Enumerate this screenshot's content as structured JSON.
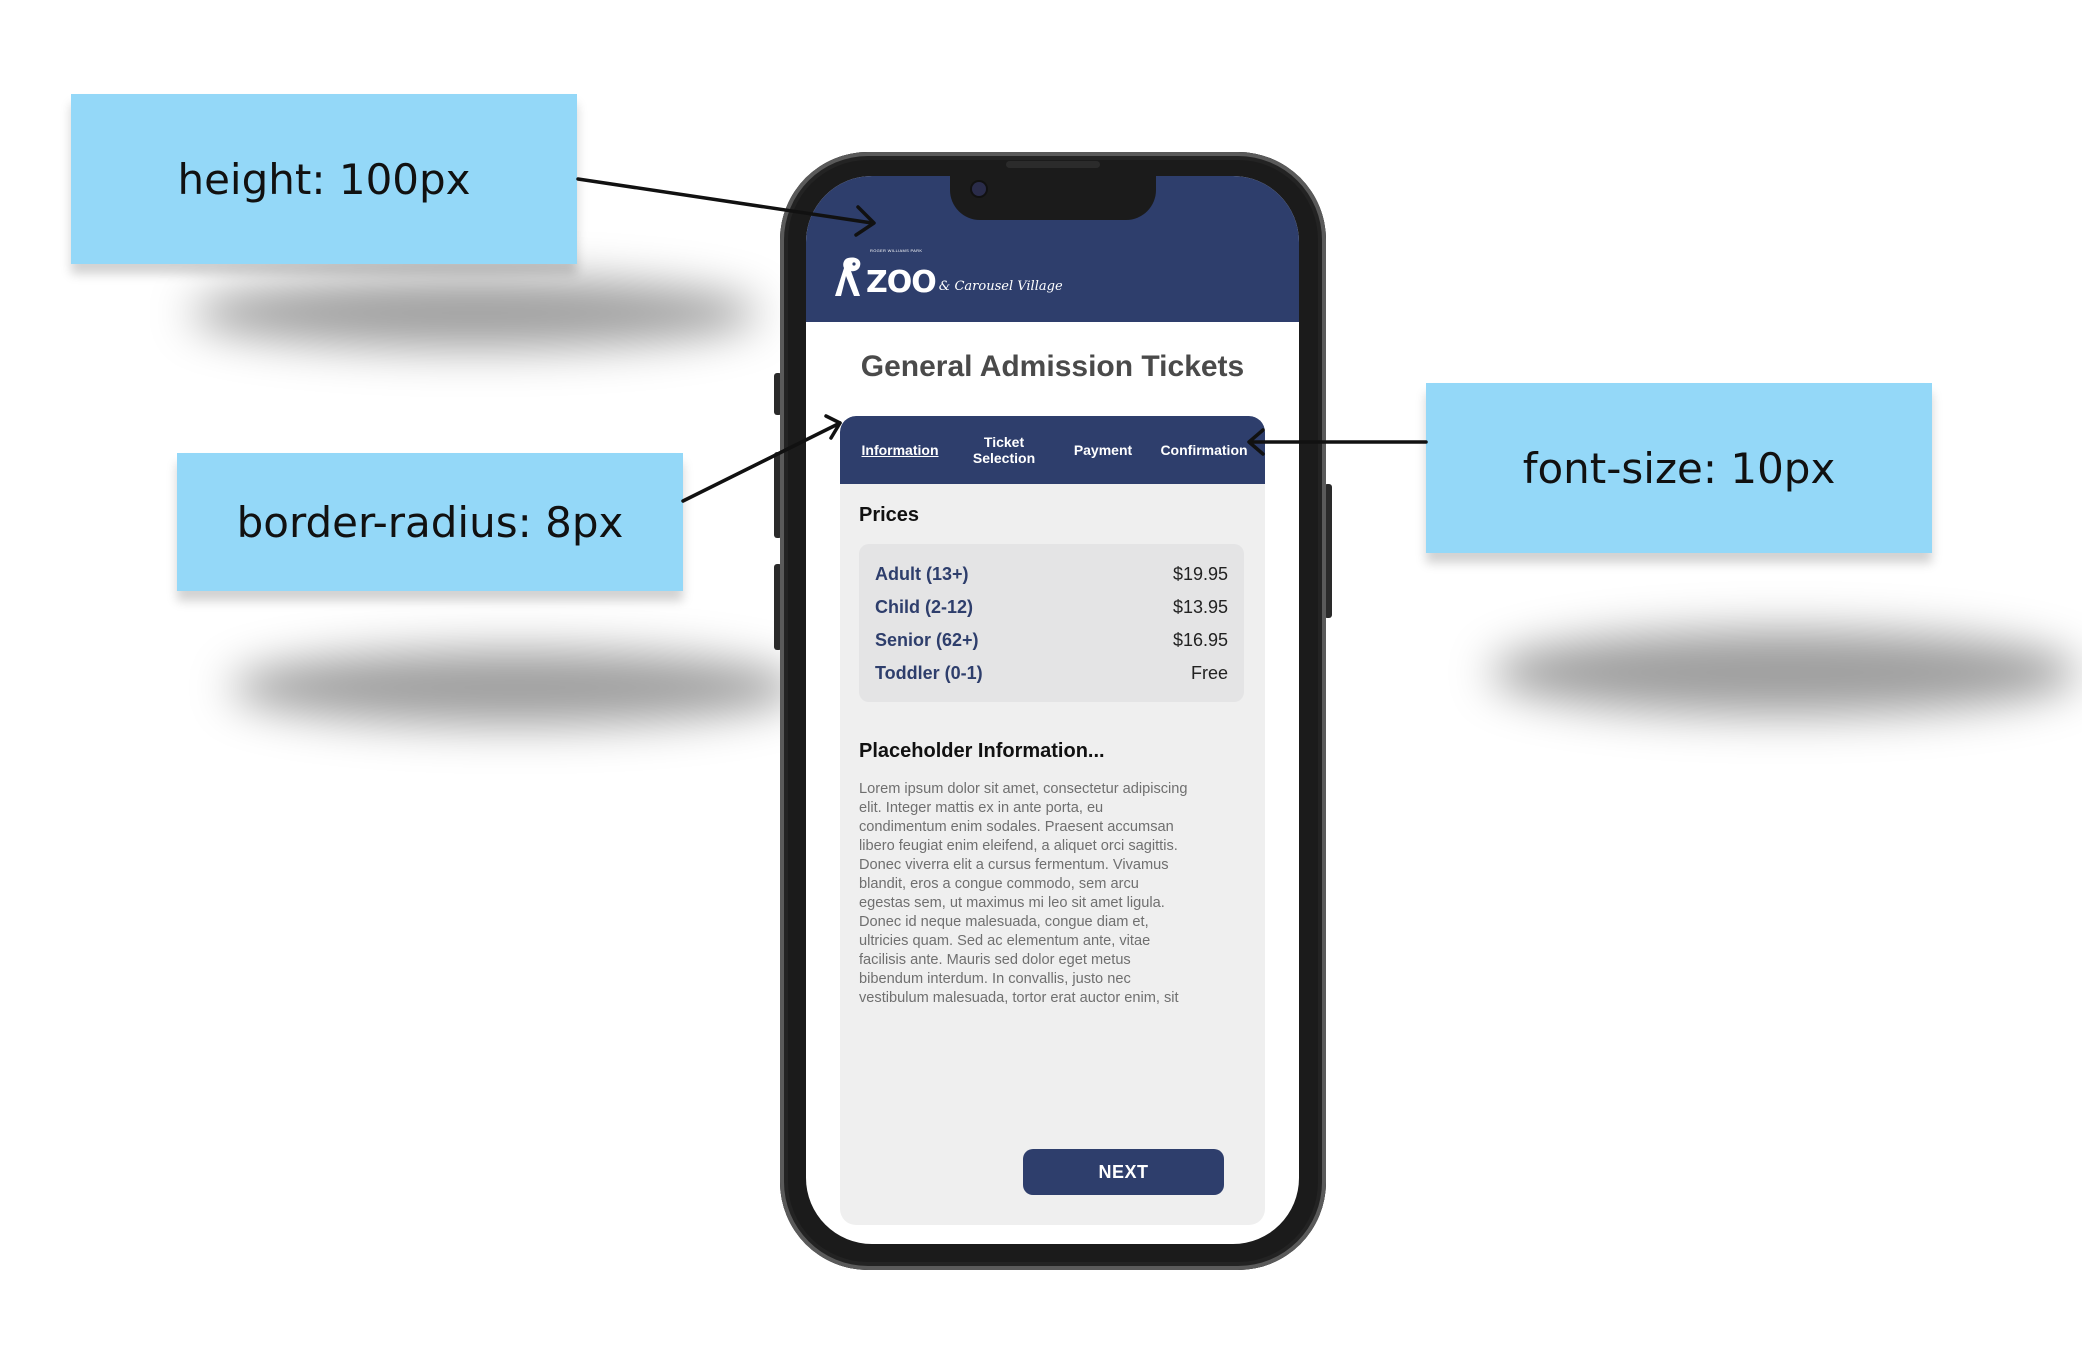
{
  "annotations": [
    {
      "text": "height: 100px"
    },
    {
      "text": "border-radius: 8px"
    },
    {
      "text": "font-size: 10px"
    }
  ],
  "logo": {
    "main": "ZOO",
    "sub": "& Carousel Village",
    "tiny": "ROGER WILLIAMS PARK"
  },
  "page": {
    "title": "General Admission Tickets"
  },
  "tabs": [
    {
      "label": "Information",
      "active": true
    },
    {
      "label": "Ticket Selection"
    },
    {
      "label": "Payment"
    },
    {
      "label": "Confirmation"
    }
  ],
  "prices": {
    "heading": "Prices",
    "rows": [
      {
        "label": "Adult (13+)",
        "value": "$19.95"
      },
      {
        "label": "Child (2-12)",
        "value": "$13.95"
      },
      {
        "label": "Senior (62+)",
        "value": "$16.95"
      },
      {
        "label": "Toddler (0-1)",
        "value": "Free"
      }
    ]
  },
  "info": {
    "heading": "Placeholder Information...",
    "body": "Lorem ipsum dolor sit amet, consectetur adipiscing\nelit. Integer mattis ex in ante porta, eu\ncondimentum enim sodales. Praesent accumsan\nlibero feugiat enim eleifend, a aliquet orci sagittis.\nDonec viverra elit a cursus fermentum. Vivamus\nblandit, eros a congue commodo, sem arcu\negestas sem, ut maximus mi leo sit amet ligula.\nDonec id neque malesuada, congue diam et,\nultricies quam. Sed ac elementum ante, vitae\nfacilisis ante. Mauris sed dolor eget metus\nbibendum interdum. In convallis, justo nec\nvestibulum malesuada, tortor erat auctor enim, sit"
  },
  "next_label": "NEXT",
  "colors": {
    "brand_navy": "#2e3e6c",
    "note_blue": "#94d8f8",
    "card_bg": "#efefef",
    "price_box_bg": "#e4e4e5"
  },
  "icons": [
    "zoo-logo-icon",
    "front-camera-icon"
  ]
}
